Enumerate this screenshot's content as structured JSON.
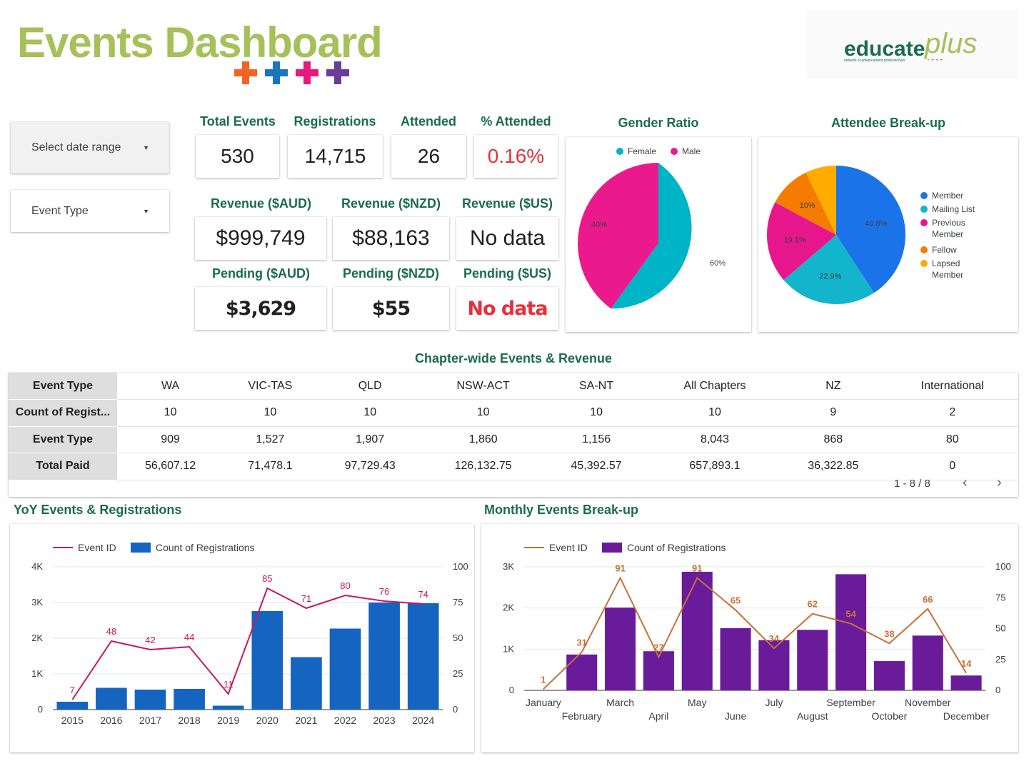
{
  "header": {
    "title": "Events Dashboard",
    "plus_colors": [
      "#f26522",
      "#1b75bc",
      "#e6197d",
      "#6a3d9a"
    ],
    "logo": {
      "word": "educate",
      "script": "plus",
      "tagline": "network of advancement professionals"
    }
  },
  "controls": {
    "date_range": "Select date range",
    "event_type": "Event Type"
  },
  "kpis": {
    "total_events": {
      "label": "Total Events",
      "value": "530"
    },
    "registrations": {
      "label": "Registrations",
      "value": "14,715"
    },
    "attended": {
      "label": "Attended",
      "value": "26"
    },
    "pct_attended": {
      "label": "% Attended",
      "value": "0.16%"
    },
    "revenue_aud": {
      "label": "Revenue ($AUD)",
      "value": "$999,749"
    },
    "revenue_nzd": {
      "label": "Revenue ($NZD)",
      "value": "$88,163"
    },
    "revenue_us": {
      "label": "Revenue ($US)",
      "value": "No data"
    },
    "pending_aud": {
      "label": "Pending ($AUD)",
      "value": "$3,629"
    },
    "pending_nzd": {
      "label": "Pending ($NZD)",
      "value": "$55"
    },
    "pending_us": {
      "label": "Pending ($US)",
      "value": "No data"
    }
  },
  "colors": {
    "title": "#a6c05a",
    "label": "#1b6b4e",
    "alert": "#e8303a",
    "female": "#00b4c8",
    "male": "#eb1a8c",
    "bar_blue": "#1565c0",
    "line_pink": "#c8175f",
    "bar_purple": "#6a1b9a",
    "line_orange": "#c8703a"
  },
  "gender": {
    "title": "Gender Ratio",
    "legend": [
      "Female",
      "Male"
    ],
    "labels": [
      "60%",
      "40%"
    ]
  },
  "attendee": {
    "title": "Attendee Break-up",
    "legend": [
      {
        "text": [
          "Member"
        ],
        "color": "#1a73e8"
      },
      {
        "text": [
          "Mailing List"
        ],
        "color": "#12b5cb"
      },
      {
        "text": [
          "Previous",
          "Member"
        ],
        "color": "#e8168c"
      },
      {
        "text": [
          "Fellow"
        ],
        "color": "#f57c00"
      },
      {
        "text": [
          "Lapsed",
          "Member"
        ],
        "color": "#ffab00"
      }
    ],
    "labels": [
      "40.8%",
      "22.9%",
      "19.1%",
      "10%"
    ]
  },
  "chapter_table": {
    "title": "Chapter-wide Events & Revenue",
    "rows": [
      {
        "header": "Event Type",
        "cells": [
          "WA",
          "VIC-TAS",
          "QLD",
          "NSW-ACT",
          "SA-NT",
          "All Chapters",
          "NZ",
          "International"
        ]
      },
      {
        "header": "Count of Regist...",
        "cells": [
          "10",
          "10",
          "10",
          "10",
          "10",
          "10",
          "9",
          "2"
        ]
      },
      {
        "header": "Event Type",
        "cells": [
          "909",
          "1,527",
          "1,907",
          "1,860",
          "1,156",
          "8,043",
          "868",
          "80"
        ]
      },
      {
        "header": "Total Paid",
        "cells": [
          "56,607.12",
          "71,478.1",
          "97,729.43",
          "126,132.75",
          "45,392.57",
          "657,893.1",
          "36,322.85",
          "0"
        ]
      }
    ],
    "pagination": "1 - 8 / 8"
  },
  "chart_data": [
    {
      "type": "bar",
      "title": "YoY Events & Registrations",
      "categories": [
        "2015",
        "2016",
        "2017",
        "2018",
        "2019",
        "2020",
        "2021",
        "2022",
        "2023",
        "2024"
      ],
      "series": [
        {
          "name": "Count of Registrations",
          "kind": "bar",
          "axis": "left",
          "values": [
            220,
            610,
            560,
            580,
            110,
            2760,
            1470,
            2270,
            3000,
            2980
          ]
        },
        {
          "name": "Event ID",
          "kind": "line",
          "axis": "right",
          "values": [
            7,
            48,
            42,
            44,
            11,
            85,
            71,
            80,
            76,
            74
          ]
        }
      ],
      "left_ticks": [
        "0",
        "1K",
        "2K",
        "3K",
        "4K"
      ],
      "right_ticks": [
        "0",
        "25",
        "50",
        "75",
        "100"
      ],
      "ylim_left": [
        0,
        4000
      ],
      "ylim_right": [
        0,
        100
      ],
      "legend_position": "top-left",
      "grid": true
    },
    {
      "type": "bar",
      "title": "Monthly Events Break-up",
      "categories": [
        "January",
        "February",
        "March",
        "April",
        "May",
        "June",
        "July",
        "August",
        "September",
        "October",
        "November",
        "December"
      ],
      "series": [
        {
          "name": "Count of Registrations",
          "kind": "bar",
          "axis": "left",
          "values": [
            0,
            870,
            2010,
            950,
            2880,
            1510,
            1220,
            1470,
            2820,
            710,
            1330,
            360
          ]
        },
        {
          "name": "Event ID",
          "kind": "line",
          "axis": "right",
          "values": [
            1,
            31,
            91,
            27,
            91,
            65,
            34,
            62,
            54,
            38,
            66,
            14
          ]
        }
      ],
      "left_ticks": [
        "0",
        "1K",
        "2K",
        "3K"
      ],
      "right_ticks": [
        "0",
        "25",
        "50",
        "75",
        "100"
      ],
      "ylim_left": [
        0,
        3000
      ],
      "ylim_right": [
        0,
        100
      ],
      "legend_position": "top-left",
      "grid": true
    }
  ]
}
